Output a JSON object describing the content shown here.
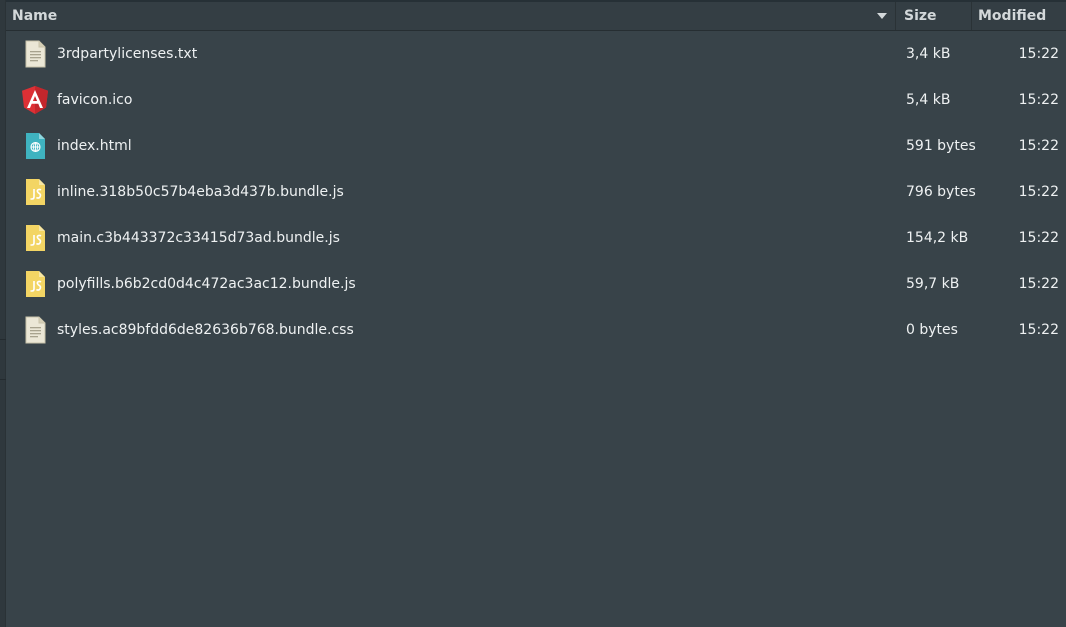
{
  "columns": {
    "name": "Name",
    "size": "Size",
    "modified": "Modified"
  },
  "files": [
    {
      "name": "3rdpartylicenses.txt",
      "size": "3,4 kB",
      "modified": "15:22",
      "icon": "text-file-icon"
    },
    {
      "name": "favicon.ico",
      "size": "5,4 kB",
      "modified": "15:22",
      "icon": "angular-icon"
    },
    {
      "name": "index.html",
      "size": "591 bytes",
      "modified": "15:22",
      "icon": "html-file-icon"
    },
    {
      "name": "inline.318b50c57b4eba3d437b.bundle.js",
      "size": "796 bytes",
      "modified": "15:22",
      "icon": "js-file-icon"
    },
    {
      "name": "main.c3b443372c33415d73ad.bundle.js",
      "size": "154,2 kB",
      "modified": "15:22",
      "icon": "js-file-icon"
    },
    {
      "name": "polyfills.b6b2cd0d4c472ac3ac12.bundle.js",
      "size": "59,7 kB",
      "modified": "15:22",
      "icon": "js-file-icon"
    },
    {
      "name": "styles.ac89bfdd6de82636b768.bundle.css",
      "size": "0 bytes",
      "modified": "15:22",
      "icon": "text-file-icon"
    }
  ],
  "colors": {
    "background": "#384349",
    "header": "#343e44",
    "text": "#eef1f2",
    "js_icon": "#f3d564",
    "html_icon": "#3fb3c0",
    "angular_icon": "#dd3035"
  }
}
